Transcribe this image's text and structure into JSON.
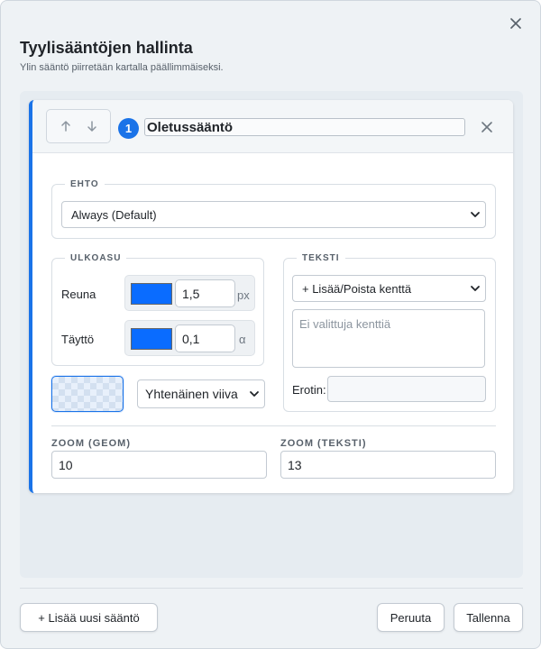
{
  "dialog": {
    "title": "Tyylisääntöjen hallinta",
    "subtitle": "Ylin sääntö piirretään kartalla päällimmäiseksi."
  },
  "rule": {
    "index": "1",
    "name": "Oletussääntö",
    "condition": {
      "legend": "EHTO",
      "selected": "Always (Default)"
    },
    "appearance": {
      "legend": "ULKOASU",
      "stroke_label": "Reuna",
      "stroke_color": "#0a6cff",
      "stroke_width": "1,5",
      "stroke_unit": "px",
      "fill_label": "Täyttö",
      "fill_color": "#0a6cff",
      "fill_opacity": "0,1",
      "fill_unit": "α",
      "line_style": "Yhtenäinen viiva"
    },
    "text": {
      "legend": "TEKSTI",
      "field_select": "+ Lisää/Poista kenttä",
      "no_fields": "Ei valittuja kenttiä",
      "separator_label": "Erotin:",
      "separator_value": ""
    },
    "zoom": {
      "geom_label": "ZOOM (GEOM)",
      "geom_value": "10",
      "text_label": "ZOOM (TEKSTI)",
      "text_value": "13"
    }
  },
  "footer": {
    "add_rule": "+ Lisää uusi sääntö",
    "cancel": "Peruuta",
    "save": "Tallenna"
  },
  "colors": {
    "accent": "#1a73e8"
  }
}
